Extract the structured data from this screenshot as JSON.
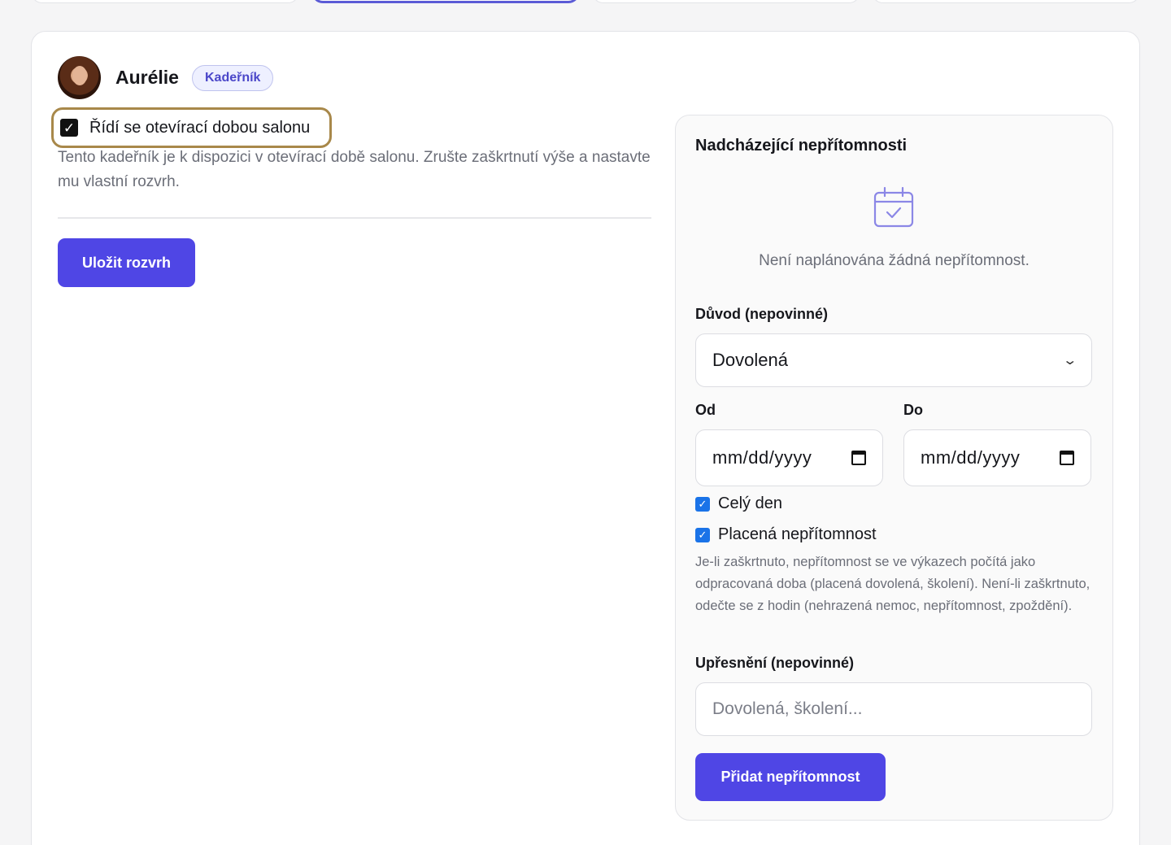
{
  "staff": {
    "name": "Aurélie",
    "role": "Kadeřník"
  },
  "schedule": {
    "follow_salon_hours_label": "Řídí se otevírací dobou salonu",
    "follow_salon_hours_checked": true,
    "help_text": "Tento kadeřník je k dispozici v otevírací době salonu. Zrušte zaškrtnutí výše a nastavte mu vlastní rozvrh.",
    "save_label": "Uložit rozvrh"
  },
  "absences": {
    "title": "Nadcházející nepřítomnosti",
    "empty_text": "Není naplánována žádná nepřítomnost.",
    "reason_label": "Důvod (nepovinné)",
    "reason_value": "Dovolená",
    "from_label": "Od",
    "from_placeholder": "mm/dd/yyyy",
    "to_label": "Do",
    "to_placeholder": "mm/dd/yyyy",
    "all_day_label": "Celý den",
    "all_day_checked": true,
    "paid_label": "Placená nepřítomnost",
    "paid_checked": true,
    "paid_help": "Je-li zaškrtnuto, nepřítomnost se ve výkazech počítá jako odpracovaná doba (placená dovolená, školení). Není-li zaškrtnuto, odečte se z hodin (nehrazená nemoc, nepřítomnost, zpoždění).",
    "note_label": "Upřesnění (nepovinné)",
    "note_placeholder": "Dovolená, školení...",
    "add_label": "Přidat nepřítomnost"
  },
  "colors": {
    "accent": "#4f46e5",
    "highlight_border": "#a8884a",
    "checkbox_blue": "#1a73e8"
  },
  "icons": [
    "calendar-check-icon",
    "chevron-down-icon",
    "calendar-icon",
    "check-icon"
  ]
}
